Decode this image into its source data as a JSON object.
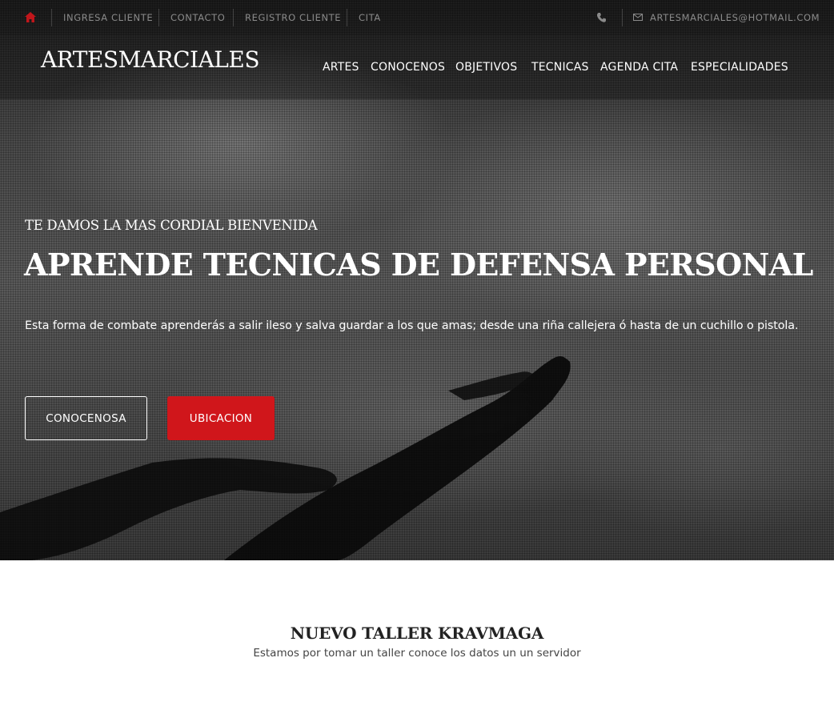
{
  "topbar": {
    "links": [
      "INGRESA CLIENTE",
      "CONTACTO",
      "REGISTRO CLIENTE",
      "CITA"
    ],
    "email": "ARTESMARCIALES@HOTMAIL.COM",
    "icons": {
      "home": "home-icon",
      "phone": "phone-icon",
      "mail": "mail-icon"
    }
  },
  "header": {
    "logo": "ARTESMARCIALES",
    "nav": [
      "ARTES",
      "CONOCENOS",
      "OBJETIVOS",
      "TECNICAS",
      "AGENDA CITA",
      "ESPECIALIDADES"
    ]
  },
  "hero": {
    "welcome": "TE DAMOS LA MAS CORDIAL BIENVENIDA",
    "headline": "APRENDE TECNICAS DE DEFENSA PERSONAL",
    "tagline": "Esta forma de combate aprenderás a salir ileso y salva guardar a los que amas; desde una riña callejera ó hasta de un cuchillo o pistola.",
    "buttons": {
      "primary": "CONOCENOSA",
      "secondary": "UBICACION"
    }
  },
  "section": {
    "title": "NUEVO TALLER KRAVMAGA",
    "subtitle": "Estamos por tomar un taller conoce los datos un un servidor"
  },
  "colors": {
    "accent": "#d0161b",
    "home_icon": "#c0161b"
  }
}
